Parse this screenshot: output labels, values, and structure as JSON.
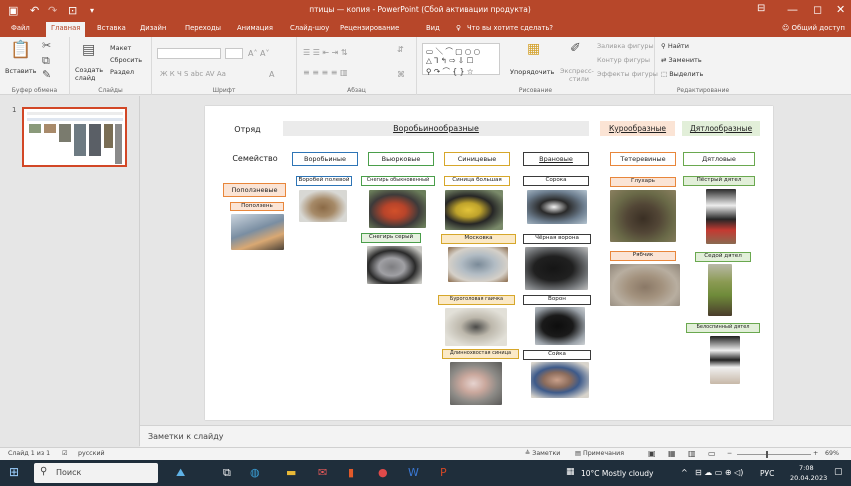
{
  "app": {
    "title": "птицы — копия - PowerPoint (Сбой активации продукта)",
    "share": "Общий доступ",
    "colors": {
      "accent": "#b7472a",
      "thumb_border": "#d24726"
    }
  },
  "tabs": [
    "Файл",
    "Главная",
    "Вставка",
    "Дизайн",
    "Переходы",
    "Анимация",
    "Слайд-шоу",
    "Рецензирование",
    "Вид"
  ],
  "tell_me": "Что вы хотите сделать?",
  "ribbon": {
    "clipboard": {
      "paste": "Вставить",
      "label": "Буфер обмена"
    },
    "slides": {
      "layout": "Макет",
      "reset": "Сбросить",
      "section": "Раздел",
      "new1": "Создать",
      "new2": "слайд",
      "label": "Слайды"
    },
    "font": {
      "label": "Шрифт"
    },
    "paragraph": {
      "label": "Абзац"
    },
    "drawing": {
      "arrange": "Упорядочить",
      "quick1": "Экспресс-",
      "quick2": "стили",
      "fill": "Заливка фигуры",
      "outline": "Контур фигуры",
      "effects": "Эффекты фигуры",
      "label": "Рисование"
    },
    "editing": {
      "find": "Найти",
      "replace": "Заменить",
      "select": "Выделить",
      "label": "Редактирование"
    }
  },
  "thumbs": {
    "number": "1"
  },
  "slide": {
    "order_label": "Отряд",
    "family_label": "Семейство",
    "orders": [
      "Воробьинообразные",
      "Курообразные",
      "Дятлообразные"
    ],
    "families": [
      {
        "name": "Поползневые"
      },
      {
        "name": "Воробьиные"
      },
      {
        "name": "Вьюрковые"
      },
      {
        "name": "Синицевые"
      },
      {
        "name": "Врановые"
      },
      {
        "name": "Тетеревиные"
      },
      {
        "name": "Дятловые"
      }
    ],
    "birds": [
      {
        "name": "Поползень"
      },
      {
        "name": "Воробей полевой"
      },
      {
        "name": "Снегирь обыкновенный"
      },
      {
        "name": "Снегирь серый"
      },
      {
        "name": "Синица большая"
      },
      {
        "name": "Московка"
      },
      {
        "name": "Буроголовая гаичка"
      },
      {
        "name": "Длиннохвостая синица"
      },
      {
        "name": "Сорока"
      },
      {
        "name": "Чёрная ворона"
      },
      {
        "name": "Ворон"
      },
      {
        "name": "Сойка"
      },
      {
        "name": "Глухарь"
      },
      {
        "name": "Рябчик"
      },
      {
        "name": "Пёстрый дятел"
      },
      {
        "name": "Седой дятел"
      },
      {
        "name": "Белоспинный дятел"
      }
    ]
  },
  "notes": "Заметки к слайду",
  "status": {
    "slide": "Слайд 1 из 1",
    "lang": "русский",
    "notes_btn": "Заметки",
    "comments_btn": "Примечания",
    "zoom": "69%"
  },
  "taskbar": {
    "search": "Поиск",
    "weather": "10°C Mostly cloudy",
    "lang": "РУС",
    "time": "7:08",
    "date": "20.04.2023"
  }
}
